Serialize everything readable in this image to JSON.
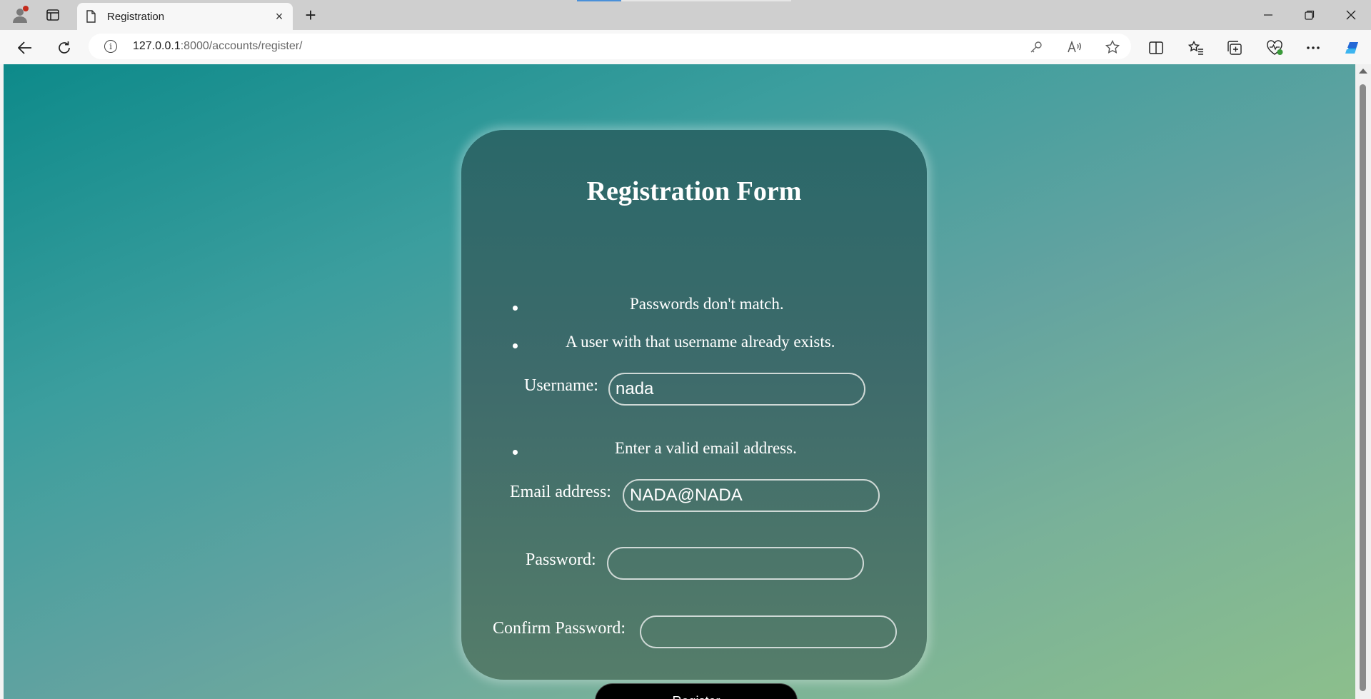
{
  "browser": {
    "tab_title": "Registration",
    "tab_close": "×",
    "new_tab": "+",
    "url_host": "127.0.0.1",
    "url_rest": ":8000/accounts/register/",
    "info_glyph": "i"
  },
  "form": {
    "title": "Registration Form",
    "errors_top": [
      "Passwords don't match.",
      "A user with that username already exists."
    ],
    "username_label": "Username:",
    "username_value": "nada",
    "email_error": "Enter a valid email address.",
    "email_label": "Email address:",
    "email_value": "NADA@NADA",
    "password_label": "Password:",
    "password_value": "",
    "confirm_label": "Confirm Password:",
    "confirm_value": "",
    "register_label": "Register"
  }
}
